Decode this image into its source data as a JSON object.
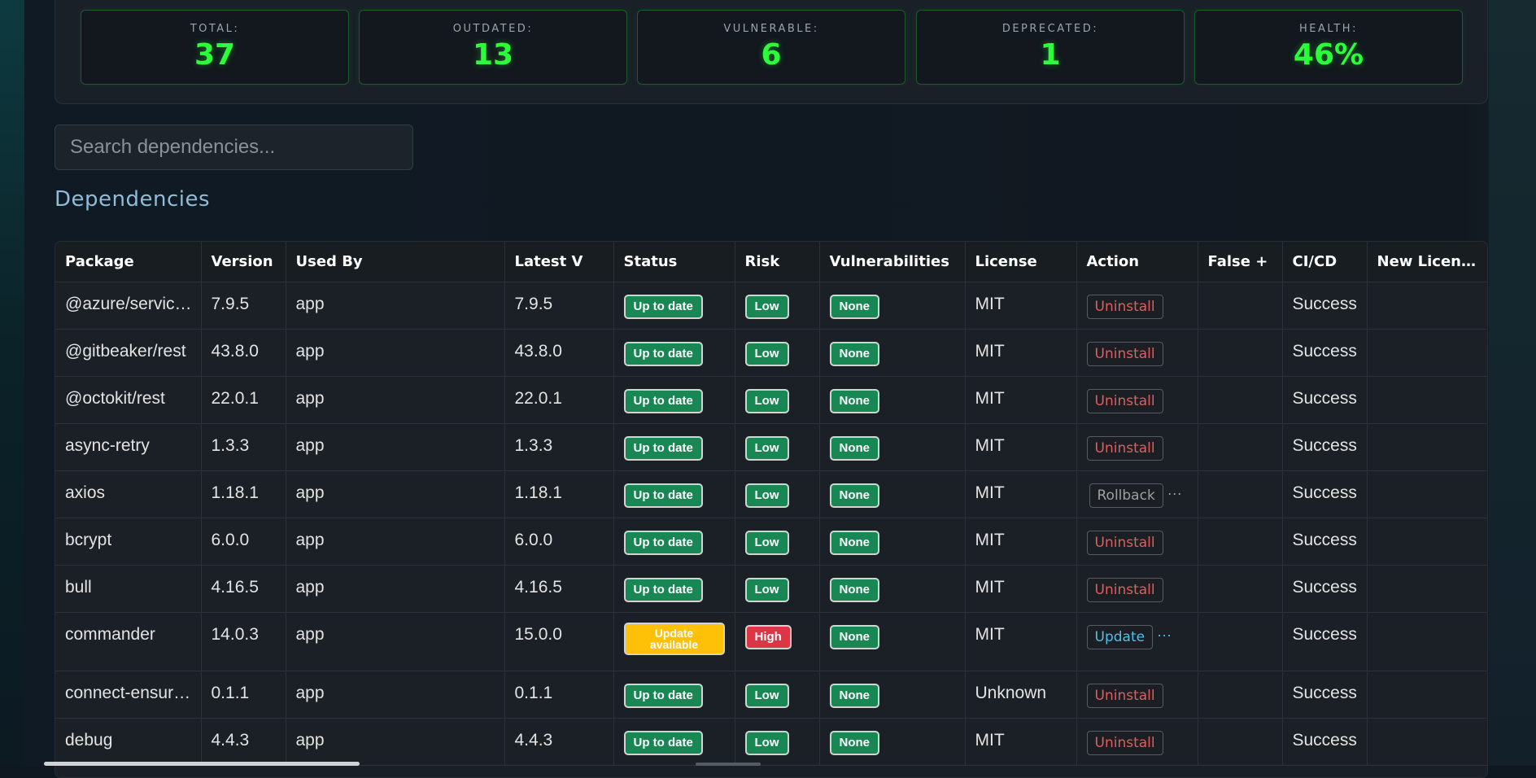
{
  "stats": [
    {
      "label": "TOTAL:",
      "value": "37"
    },
    {
      "label": "OUTDATED:",
      "value": "13"
    },
    {
      "label": "VULNERABLE:",
      "value": "6"
    },
    {
      "label": "DEPRECATED:",
      "value": "1"
    },
    {
      "label": "HEALTH:",
      "value": "46%"
    }
  ],
  "search": {
    "placeholder": "Search dependencies..."
  },
  "section_title": "Dependencies",
  "columns": [
    "Package",
    "Version",
    "Used By",
    "Latest V",
    "Status",
    "Risk",
    "Vulnerabilities",
    "License",
    "Action",
    "False +",
    "CI/CD",
    "New Licen…"
  ],
  "rows": [
    {
      "package": "@azure/servic…",
      "version": "7.9.5",
      "used_by": "app",
      "latest": "7.9.5",
      "status": "Up to date",
      "risk": "Low",
      "vulns": "None",
      "license": "MIT",
      "action": "Uninstall",
      "false_pos": "",
      "cicd": "Success",
      "new_license": ""
    },
    {
      "package": "@gitbeaker/rest",
      "version": "43.8.0",
      "used_by": "app",
      "latest": "43.8.0",
      "status": "Up to date",
      "risk": "Low",
      "vulns": "None",
      "license": "MIT",
      "action": "Uninstall",
      "false_pos": "",
      "cicd": "Success",
      "new_license": ""
    },
    {
      "package": "@octokit/rest",
      "version": "22.0.1",
      "used_by": "app",
      "latest": "22.0.1",
      "status": "Up to date",
      "risk": "Low",
      "vulns": "None",
      "license": "MIT",
      "action": "Uninstall",
      "false_pos": "",
      "cicd": "Success",
      "new_license": ""
    },
    {
      "package": "async-retry",
      "version": "1.3.3",
      "used_by": "app",
      "latest": "1.3.3",
      "status": "Up to date",
      "risk": "Low",
      "vulns": "None",
      "license": "MIT",
      "action": "Uninstall",
      "false_pos": "",
      "cicd": "Success",
      "new_license": ""
    },
    {
      "package": "axios",
      "version": "1.18.1",
      "used_by": "app",
      "latest": "1.18.1",
      "status": "Up to date",
      "risk": "Low",
      "vulns": "None",
      "license": "MIT",
      "action": "Rollback",
      "more": "···",
      "false_pos": "",
      "cicd": "Success",
      "new_license": ""
    },
    {
      "package": "bcrypt",
      "version": "6.0.0",
      "used_by": "app",
      "latest": "6.0.0",
      "status": "Up to date",
      "risk": "Low",
      "vulns": "None",
      "license": "MIT",
      "action": "Uninstall",
      "false_pos": "",
      "cicd": "Success",
      "new_license": ""
    },
    {
      "package": "bull",
      "version": "4.16.5",
      "used_by": "app",
      "latest": "4.16.5",
      "status": "Up to date",
      "risk": "Low",
      "vulns": "None",
      "license": "MIT",
      "action": "Uninstall",
      "false_pos": "",
      "cicd": "Success",
      "new_license": ""
    },
    {
      "package": "commander",
      "version": "14.0.3",
      "used_by": "app",
      "latest": "15.0.0",
      "status": "Update available",
      "risk": "High",
      "vulns": "None",
      "license": "MIT",
      "action": "Update",
      "more": "···",
      "false_pos": "",
      "cicd": "Success",
      "new_license": ""
    },
    {
      "package": "connect-ensur…",
      "version": "0.1.1",
      "used_by": "app",
      "latest": "0.1.1",
      "status": "Up to date",
      "risk": "Low",
      "vulns": "None",
      "license": "Unknown",
      "action": "Uninstall",
      "false_pos": "",
      "cicd": "Success",
      "new_license": ""
    },
    {
      "package": "debug",
      "version": "4.4.3",
      "used_by": "app",
      "latest": "4.4.3",
      "status": "Up to date",
      "risk": "Low",
      "vulns": "None",
      "license": "MIT",
      "action": "Uninstall",
      "false_pos": "",
      "cicd": "Success",
      "new_license": ""
    }
  ],
  "colors": {
    "stat_value": "#2bff3a",
    "badge_green": "#198754",
    "badge_red": "#dc3545",
    "badge_yellow": "#ffc107",
    "action_danger": "#e05d5d",
    "action_info": "#4cc0e6",
    "section_title": "#8fbcd6"
  },
  "icons": {
    "more": "ellipsis-icon"
  }
}
